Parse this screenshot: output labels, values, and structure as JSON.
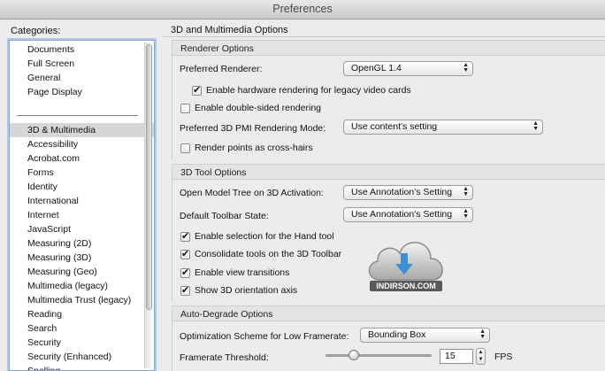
{
  "window": {
    "title": "Preferences"
  },
  "sidebar": {
    "label": "Categories:",
    "top_items": [
      "Documents",
      "Full Screen",
      "General",
      "Page Display"
    ],
    "items": [
      "3D & Multimedia",
      "Accessibility",
      "Acrobat.com",
      "Forms",
      "Identity",
      "International",
      "Internet",
      "JavaScript",
      "Measuring (2D)",
      "Measuring (3D)",
      "Measuring (Geo)",
      "Multimedia (legacy)",
      "Multimedia Trust (legacy)",
      "Reading",
      "Search",
      "Security",
      "Security (Enhanced)",
      "Spelling"
    ],
    "selected": "3D & Multimedia"
  },
  "main": {
    "title": "3D and Multimedia Options",
    "renderer": {
      "heading": "Renderer Options",
      "preferred_renderer_label": "Preferred Renderer:",
      "preferred_renderer_value": "OpenGL 1.4",
      "hw_legacy_label": "Enable hardware rendering for legacy video cards",
      "hw_legacy_checked": true,
      "double_sided_label": "Enable double-sided rendering",
      "double_sided_checked": false,
      "pmi_label": "Preferred 3D PMI Rendering Mode:",
      "pmi_value": "Use content's setting",
      "crosshairs_label": "Render points as cross-hairs",
      "crosshairs_checked": false
    },
    "tool": {
      "heading": "3D Tool Options",
      "model_tree_label": "Open Model Tree on 3D Activation:",
      "model_tree_value": "Use Annotation's Setting",
      "toolbar_state_label": "Default Toolbar State:",
      "toolbar_state_value": "Use Annotation's Setting",
      "hand_tool_label": "Enable selection for the Hand tool",
      "consolidate_label": "Consolidate tools on the 3D Toolbar",
      "view_transitions_label": "Enable view transitions",
      "orientation_axis_label": "Show 3D orientation axis"
    },
    "degrade": {
      "heading": "Auto-Degrade Options",
      "scheme_label": "Optimization Scheme for Low Framerate:",
      "scheme_value": "Bounding Box",
      "threshold_label": "Framerate Threshold:",
      "threshold_value": "15",
      "threshold_slider_fraction": 0.27,
      "fps_label": "FPS"
    }
  },
  "watermark": {
    "text": "INDIRSON.COM"
  }
}
